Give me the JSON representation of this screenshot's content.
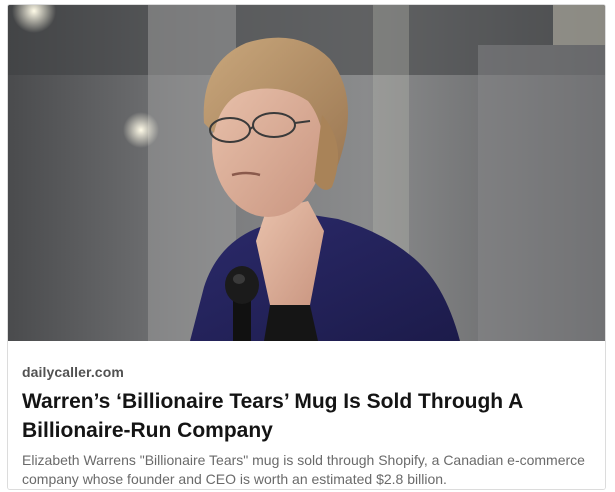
{
  "link_preview": {
    "image": "photo-woman-speaking-at-microphone",
    "domain": "dailycaller.com",
    "headline": "Warren’s ‘Billionaire Tears’ Mug Is Sold Through A Billionaire-Run Company",
    "description": "Elizabeth Warrens \"Billionaire Tears\" mug is sold through Shopify, a Canadian e-commerce company whose founder and CEO is worth an estimated $2.8 billion."
  },
  "colors": {
    "headline": "#141414",
    "domain": "#525252",
    "description": "#6a6a6a",
    "border": "#dcdcdc"
  }
}
